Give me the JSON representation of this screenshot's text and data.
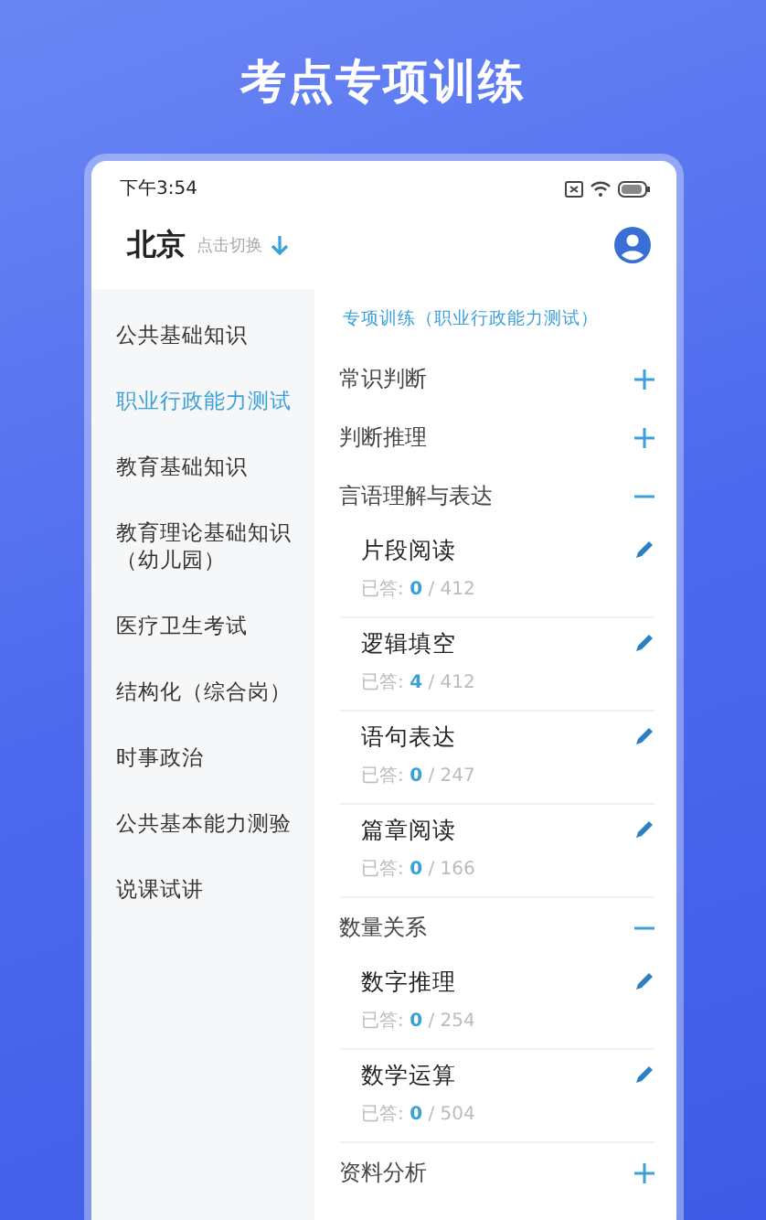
{
  "banner": {
    "title": "考点专项训练"
  },
  "status_bar": {
    "time": "下午3:54"
  },
  "header": {
    "city": "北京",
    "switch_hint": "点击切换"
  },
  "sidebar": {
    "items": [
      {
        "label": "公共基础知识",
        "selected": false
      },
      {
        "label": "职业行政能力测试",
        "selected": true
      },
      {
        "label": "教育基础知识",
        "selected": false
      },
      {
        "label": "教育理论基础知识（幼儿园）",
        "selected": false
      },
      {
        "label": "医疗卫生考试",
        "selected": false
      },
      {
        "label": "结构化（综合岗）",
        "selected": false
      },
      {
        "label": "时事政治",
        "selected": false
      },
      {
        "label": "公共基本能力测验",
        "selected": false
      },
      {
        "label": "说课试讲",
        "selected": false
      }
    ]
  },
  "content": {
    "heading": "专项训练（职业行政能力测试）",
    "groups": [
      {
        "name": "常识判断",
        "expanded": false
      },
      {
        "name": "判断推理",
        "expanded": false
      },
      {
        "name": "言语理解与表达",
        "expanded": true,
        "items": [
          {
            "name": "片段阅读",
            "answered_label": "已答:",
            "answered": "0",
            "total": "/ 412"
          },
          {
            "name": "逻辑填空",
            "answered_label": "已答:",
            "answered": "4",
            "total": "/ 412"
          },
          {
            "name": "语句表达",
            "answered_label": "已答:",
            "answered": "0",
            "total": "/ 247"
          },
          {
            "name": "篇章阅读",
            "answered_label": "已答:",
            "answered": "0",
            "total": "/ 166"
          }
        ]
      },
      {
        "name": "数量关系",
        "expanded": true,
        "items": [
          {
            "name": "数字推理",
            "answered_label": "已答:",
            "answered": "0",
            "total": "/ 254"
          },
          {
            "name": "数学运算",
            "answered_label": "已答:",
            "answered": "0",
            "total": "/ 504"
          }
        ]
      },
      {
        "name": "资料分析",
        "expanded": false
      }
    ]
  }
}
